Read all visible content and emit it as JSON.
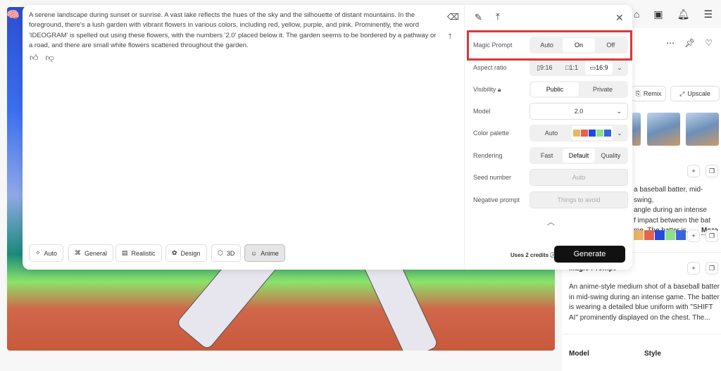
{
  "app": {
    "logo": "brain-logo-icon"
  },
  "top_icons": [
    "home-icon",
    "gallery-icon",
    "bell-icon",
    "menu-icon"
  ],
  "prompt": {
    "text": "A serene landscape during sunset or sunrise. A vast lake reflects the hues of the sky and the silhouette of distant mountains. In the foreground, there's a lush garden with vibrant flowers in various colors, including red, yellow, purple, and pink. Prominently, the word 'IDEOGRAM' is spelled out using these flowers, with the numbers '2.0' placed below it. The garden seems to be bordered by a pathway or a road, and there are small white flowers scattered throughout the garden."
  },
  "styles": [
    {
      "label": "Auto",
      "icon": "sparkle-icon"
    },
    {
      "label": "General",
      "icon": "grid-icon"
    },
    {
      "label": "Realistic",
      "icon": "photo-icon"
    },
    {
      "label": "Design",
      "icon": "design-icon"
    },
    {
      "label": "3D",
      "icon": "cube-icon"
    },
    {
      "label": "Anime",
      "icon": "anime-face-icon",
      "selected": true
    }
  ],
  "settings": {
    "magic_prompt": {
      "label": "Magic Prompt",
      "options": [
        "Auto",
        "On",
        "Off"
      ],
      "selected": "On"
    },
    "aspect_ratio": {
      "label": "Aspect ratio",
      "options": [
        "9:16",
        "1:1",
        "16:9"
      ],
      "selected": "16:9"
    },
    "visibility": {
      "label": "Visibility",
      "options": [
        "Public",
        "Private"
      ],
      "selected": "Public"
    },
    "model": {
      "label": "Model",
      "value": "2.0"
    },
    "color_palette": {
      "label": "Color palette",
      "value": "Auto",
      "swatches": [
        "#e8b565",
        "#e0654a",
        "#2448e0",
        "#8fe08a",
        "#3a63e0"
      ]
    },
    "rendering": {
      "label": "Rendering",
      "options": [
        "Fast",
        "Default",
        "Quality"
      ],
      "selected": "Default"
    },
    "seed": {
      "label": "Seed number",
      "placeholder": "Auto"
    },
    "negative": {
      "label": "Negative prompt",
      "placeholder": "Things to avoid"
    }
  },
  "credits": "Uses 2 credits",
  "generate": "Generate",
  "right_panel": {
    "remix": "Remix",
    "upscale": "Upscale",
    "prompt_lines": [
      "a baseball batter, mid-swing,",
      "angle during an intense",
      "f impact between the bat",
      "me. The batter is..."
    ],
    "more": "More",
    "swatches": [
      "#e8b565",
      "#e0654a",
      "#2448e0",
      "#8fe08a",
      "#3a63e0"
    ],
    "magic_prompt_title": "Magic Prompt",
    "magic_prompt_text": "An anime-style medium shot of a baseball batter in mid-swing during an intense game. The batter is wearing a detailed blue uniform with \"SHIFT AI\" prominently displayed on the chest. The...",
    "model_label": "Model",
    "style_label": "Style"
  },
  "highlight_color": "#d9383a"
}
